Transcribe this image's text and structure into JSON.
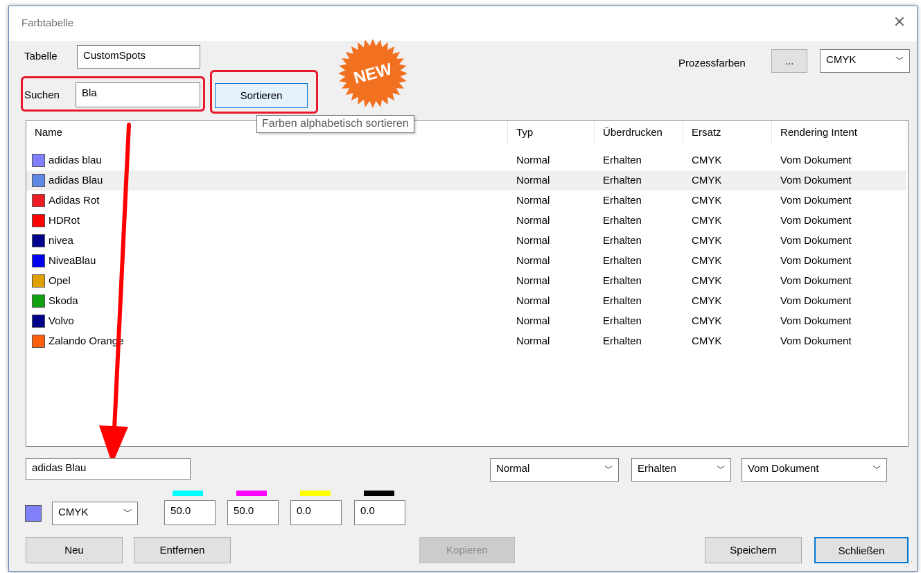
{
  "window": {
    "title": "Farbtabelle",
    "close_glyph": "✕"
  },
  "toolbar": {
    "table_label": "Tabelle",
    "table_value": "CustomSpots",
    "search_label": "Suchen",
    "search_value": "Bla",
    "sort_button": "Sortieren",
    "sort_tooltip": "Farben alphabetisch sortieren",
    "new_badge": "NEW",
    "process_label": "Prozessfarben",
    "process_more_button": "...",
    "process_mode": "CMYK"
  },
  "table": {
    "headers": [
      "Name",
      "Typ",
      "Überdrucken",
      "Ersatz",
      "Rendering Intent"
    ],
    "rows": [
      {
        "color": "#8080ff",
        "name": "adidas blau",
        "typ": "Normal",
        "over": "Erhalten",
        "ersatz": "CMYK",
        "intent": "Vom Dokument"
      },
      {
        "color": "#5f87e6",
        "name": "adidas Blau",
        "typ": "Normal",
        "over": "Erhalten",
        "ersatz": "CMYK",
        "intent": "Vom Dokument"
      },
      {
        "color": "#ee1c24",
        "name": "Adidas Rot",
        "typ": "Normal",
        "over": "Erhalten",
        "ersatz": "CMYK",
        "intent": "Vom Dokument"
      },
      {
        "color": "#ff0000",
        "name": "HDRot",
        "typ": "Normal",
        "over": "Erhalten",
        "ersatz": "CMYK",
        "intent": "Vom Dokument"
      },
      {
        "color": "#00008b",
        "name": "nivea",
        "typ": "Normal",
        "over": "Erhalten",
        "ersatz": "CMYK",
        "intent": "Vom Dokument"
      },
      {
        "color": "#0000ee",
        "name": "NiveaBlau",
        "typ": "Normal",
        "over": "Erhalten",
        "ersatz": "CMYK",
        "intent": "Vom Dokument"
      },
      {
        "color": "#e0a000",
        "name": "Opel",
        "typ": "Normal",
        "over": "Erhalten",
        "ersatz": "CMYK",
        "intent": "Vom Dokument"
      },
      {
        "color": "#10a010",
        "name": "Skoda",
        "typ": "Normal",
        "over": "Erhalten",
        "ersatz": "CMYK",
        "intent": "Vom Dokument"
      },
      {
        "color": "#000088",
        "name": "Volvo",
        "typ": "Normal",
        "over": "Erhalten",
        "ersatz": "CMYK",
        "intent": "Vom Dokument"
      },
      {
        "color": "#ff6010",
        "name": "Zalando Orange",
        "typ": "Normal",
        "over": "Erhalten",
        "ersatz": "CMYK",
        "intent": "Vom Dokument"
      }
    ],
    "hover_row_index": 1
  },
  "edit": {
    "name_value": "adidas Blau",
    "type_select": "Normal",
    "overprint_select": "Erhalten",
    "intent_select": "Vom Dokument",
    "current_color": "#8080f8",
    "mode_select": "CMYK",
    "channels": [
      {
        "color": "#00ffff",
        "value": "50.0"
      },
      {
        "color": "#ff00ff",
        "value": "50.0"
      },
      {
        "color": "#ffff00",
        "value": "0.0"
      },
      {
        "color": "#000000",
        "value": "0.0"
      }
    ]
  },
  "buttons": {
    "new": "Neu",
    "remove": "Entfernen",
    "copy": "Kopieren",
    "save": "Speichern",
    "close": "Schließen"
  },
  "colors": {
    "highlight": "#e8192c",
    "badge": "#f27121",
    "arrow": "#ff0000",
    "accent": "#0078d7"
  },
  "icons": {
    "dropdown": "chevron-down-icon",
    "close": "close-icon",
    "badge": "starburst-icon"
  }
}
